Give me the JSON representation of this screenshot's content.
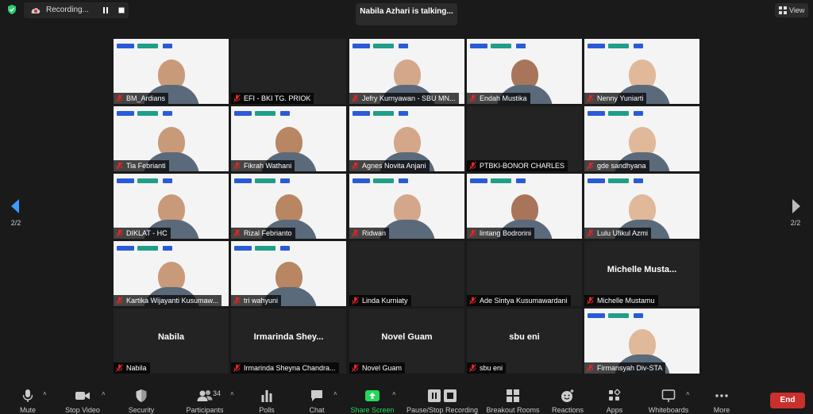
{
  "recording": {
    "label": "Recording..."
  },
  "speaker_banner": "Nabila Azhari is talking...",
  "view_label": "View",
  "pagination": {
    "left": "2/2",
    "right": "2/2"
  },
  "tiles": [
    {
      "label": "BM_Ardians",
      "big_name": "",
      "video": true
    },
    {
      "label": "EFI - BKI TG. PRIOK",
      "big_name": "",
      "video": false
    },
    {
      "label": "Jefry Kurnyawan - SBU MN...",
      "big_name": "",
      "video": true
    },
    {
      "label": "Endah Mustika",
      "big_name": "",
      "video": true
    },
    {
      "label": "Nenny Yuniarti",
      "big_name": "",
      "video": true
    },
    {
      "label": "Tia Febrianti",
      "big_name": "",
      "video": true
    },
    {
      "label": "Fikrah Wathani",
      "big_name": "",
      "video": true
    },
    {
      "label": "Agnes Novita Anjani",
      "big_name": "",
      "video": true
    },
    {
      "label": "PTBKI-BONOR CHARLES",
      "big_name": "",
      "video": false
    },
    {
      "label": "gde sandhyana",
      "big_name": "",
      "video": true
    },
    {
      "label": "DIKLAT - HC",
      "big_name": "",
      "video": true
    },
    {
      "label": "Rizal Febrianto",
      "big_name": "",
      "video": true
    },
    {
      "label": "Ridwan",
      "big_name": "",
      "video": true
    },
    {
      "label": "lintang Bodrorini",
      "big_name": "",
      "video": true
    },
    {
      "label": "Lulu Ufikul Azmi",
      "big_name": "",
      "video": true
    },
    {
      "label": "Kartika Wijayanti Kusumaw...",
      "big_name": "",
      "video": true
    },
    {
      "label": "tri wahyuni",
      "big_name": "",
      "video": true
    },
    {
      "label": "Linda Kurniaty",
      "big_name": "",
      "video": false
    },
    {
      "label": "Ade Sintya Kusumawardani",
      "big_name": "",
      "video": false
    },
    {
      "label": "Michelle Mustamu",
      "big_name": "Michelle  Musta...",
      "video": false
    },
    {
      "label": "Nabila",
      "big_name": "Nabila",
      "video": false
    },
    {
      "label": "Irmarinda Sheyna Chandra...",
      "big_name": "Irmarinda  Shey...",
      "video": false
    },
    {
      "label": "Novel Guam",
      "big_name": "Novel Guam",
      "video": false
    },
    {
      "label": "sbu eni",
      "big_name": "sbu eni",
      "video": false
    },
    {
      "label": "Firmansyah Div-STA",
      "big_name": "",
      "video": true
    }
  ],
  "toolbar": {
    "mute": "Mute",
    "stop_video": "Stop Video",
    "security": "Security",
    "participants": "Participants",
    "participants_count": "34",
    "polls": "Polls",
    "chat": "Chat",
    "share_screen": "Share Screen",
    "pause_stop_recording": "Pause/Stop Recording",
    "breakout_rooms": "Breakout Rooms",
    "reactions": "Reactions",
    "apps": "Apps",
    "whiteboards": "Whiteboards",
    "more": "More",
    "end": "End"
  },
  "colors": {
    "background": "#1a1a1a",
    "tile": "#232323",
    "end_button": "#c9302c",
    "share_green": "#23d959",
    "muted_red": "#e02828",
    "shield_green": "#2ecc71",
    "nav_arrow": "#3b9bff"
  }
}
